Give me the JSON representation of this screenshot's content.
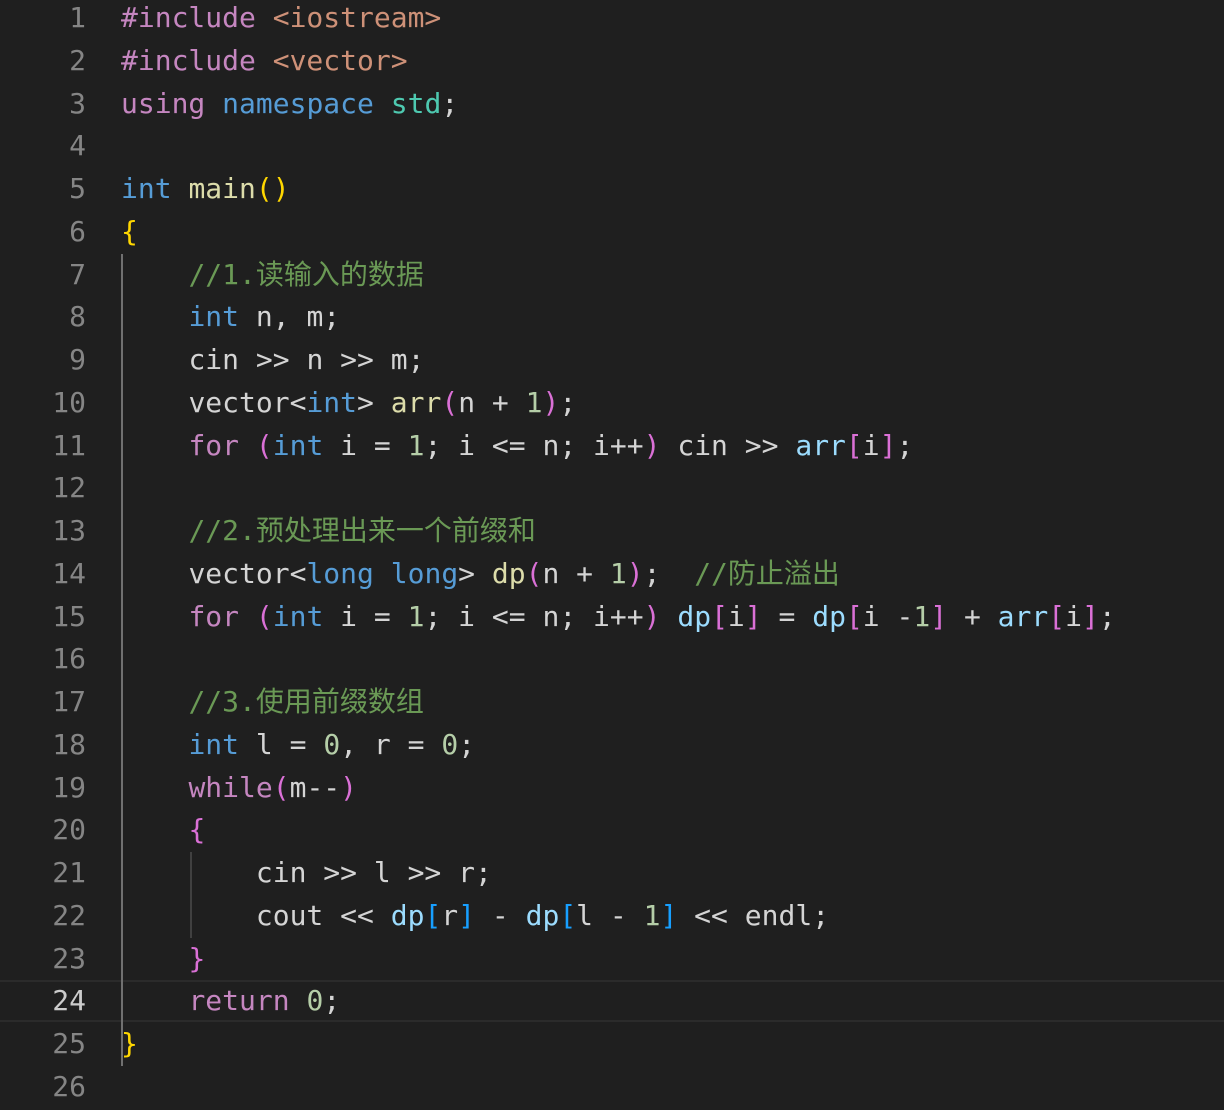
{
  "editor": {
    "language": "cpp",
    "theme": {
      "background": "#1f1f1f",
      "line_number": "#858585",
      "line_number_active": "#cccccc",
      "current_line_border": "#2b2b2b",
      "indent_guide": "#404040",
      "indent_guide_active": "#707070"
    },
    "active_line": 24,
    "lines": [
      {
        "number": "1",
        "tokens": [
          {
            "t": "#include",
            "c": "#c586c0"
          },
          {
            "t": " ",
            "c": "#d4d4d4"
          },
          {
            "t": "<iostream>",
            "c": "#ce9178"
          }
        ]
      },
      {
        "number": "2",
        "tokens": [
          {
            "t": "#include",
            "c": "#c586c0"
          },
          {
            "t": " ",
            "c": "#d4d4d4"
          },
          {
            "t": "<vector>",
            "c": "#ce9178"
          }
        ]
      },
      {
        "number": "3",
        "tokens": [
          {
            "t": "using",
            "c": "#c586c0"
          },
          {
            "t": " ",
            "c": "#d4d4d4"
          },
          {
            "t": "namespace",
            "c": "#569cd6"
          },
          {
            "t": " ",
            "c": "#d4d4d4"
          },
          {
            "t": "std",
            "c": "#4ec9b0"
          },
          {
            "t": ";",
            "c": "#d4d4d4"
          }
        ]
      },
      {
        "number": "4",
        "tokens": []
      },
      {
        "number": "5",
        "tokens": [
          {
            "t": "int",
            "c": "#569cd6"
          },
          {
            "t": " ",
            "c": "#d4d4d4"
          },
          {
            "t": "main",
            "c": "#dcdcaa"
          },
          {
            "t": "()",
            "c": "#ffd700"
          }
        ]
      },
      {
        "number": "6",
        "tokens": [
          {
            "t": "{",
            "c": "#ffd700"
          }
        ]
      },
      {
        "number": "7",
        "tokens": [
          {
            "t": "    ",
            "c": "#d4d4d4"
          },
          {
            "t": "//1.",
            "c": "#6a9955"
          },
          {
            "t": "读输入的数据",
            "c": "#6a9955",
            "cjk": true
          }
        ]
      },
      {
        "number": "8",
        "tokens": [
          {
            "t": "    ",
            "c": "#d4d4d4"
          },
          {
            "t": "int",
            "c": "#569cd6"
          },
          {
            "t": " n, m;",
            "c": "#d4d4d4"
          }
        ]
      },
      {
        "number": "9",
        "tokens": [
          {
            "t": "    ",
            "c": "#d4d4d4"
          },
          {
            "t": "cin >> n >> m;",
            "c": "#d4d4d4"
          }
        ]
      },
      {
        "number": "10",
        "tokens": [
          {
            "t": "    ",
            "c": "#d4d4d4"
          },
          {
            "t": "vector<",
            "c": "#d4d4d4"
          },
          {
            "t": "int",
            "c": "#569cd6"
          },
          {
            "t": "> ",
            "c": "#d4d4d4"
          },
          {
            "t": "arr",
            "c": "#dcdcaa"
          },
          {
            "t": "(",
            "c": "#da70d6"
          },
          {
            "t": "n + ",
            "c": "#d4d4d4"
          },
          {
            "t": "1",
            "c": "#b5cea8"
          },
          {
            "t": ")",
            "c": "#da70d6"
          },
          {
            "t": ";",
            "c": "#d4d4d4"
          }
        ]
      },
      {
        "number": "11",
        "tokens": [
          {
            "t": "    ",
            "c": "#d4d4d4"
          },
          {
            "t": "for",
            "c": "#c586c0"
          },
          {
            "t": " ",
            "c": "#d4d4d4"
          },
          {
            "t": "(",
            "c": "#da70d6"
          },
          {
            "t": "int",
            "c": "#569cd6"
          },
          {
            "t": " i = ",
            "c": "#d4d4d4"
          },
          {
            "t": "1",
            "c": "#b5cea8"
          },
          {
            "t": "; i <= n; i++",
            "c": "#d4d4d4"
          },
          {
            "t": ")",
            "c": "#da70d6"
          },
          {
            "t": " cin >> ",
            "c": "#d4d4d4"
          },
          {
            "t": "arr",
            "c": "#9cdcfe"
          },
          {
            "t": "[",
            "c": "#da70d6"
          },
          {
            "t": "i",
            "c": "#d4d4d4"
          },
          {
            "t": "]",
            "c": "#da70d6"
          },
          {
            "t": ";",
            "c": "#d4d4d4"
          }
        ]
      },
      {
        "number": "12",
        "tokens": []
      },
      {
        "number": "13",
        "tokens": [
          {
            "t": "    ",
            "c": "#d4d4d4"
          },
          {
            "t": "//2.",
            "c": "#6a9955"
          },
          {
            "t": "预处理出来一个前缀和",
            "c": "#6a9955",
            "cjk": true
          }
        ]
      },
      {
        "number": "14",
        "tokens": [
          {
            "t": "    ",
            "c": "#d4d4d4"
          },
          {
            "t": "vector<",
            "c": "#d4d4d4"
          },
          {
            "t": "long long",
            "c": "#569cd6"
          },
          {
            "t": "> ",
            "c": "#d4d4d4"
          },
          {
            "t": "dp",
            "c": "#dcdcaa"
          },
          {
            "t": "(",
            "c": "#da70d6"
          },
          {
            "t": "n + ",
            "c": "#d4d4d4"
          },
          {
            "t": "1",
            "c": "#b5cea8"
          },
          {
            "t": ")",
            "c": "#da70d6"
          },
          {
            "t": ";  ",
            "c": "#d4d4d4"
          },
          {
            "t": "//",
            "c": "#6a9955"
          },
          {
            "t": "防止溢出",
            "c": "#6a9955",
            "cjk": true
          }
        ]
      },
      {
        "number": "15",
        "tokens": [
          {
            "t": "    ",
            "c": "#d4d4d4"
          },
          {
            "t": "for",
            "c": "#c586c0"
          },
          {
            "t": " ",
            "c": "#d4d4d4"
          },
          {
            "t": "(",
            "c": "#da70d6"
          },
          {
            "t": "int",
            "c": "#569cd6"
          },
          {
            "t": " i = ",
            "c": "#d4d4d4"
          },
          {
            "t": "1",
            "c": "#b5cea8"
          },
          {
            "t": "; i <= n; i++",
            "c": "#d4d4d4"
          },
          {
            "t": ")",
            "c": "#da70d6"
          },
          {
            "t": " ",
            "c": "#d4d4d4"
          },
          {
            "t": "dp",
            "c": "#9cdcfe"
          },
          {
            "t": "[",
            "c": "#da70d6"
          },
          {
            "t": "i",
            "c": "#d4d4d4"
          },
          {
            "t": "]",
            "c": "#da70d6"
          },
          {
            "t": " = ",
            "c": "#d4d4d4"
          },
          {
            "t": "dp",
            "c": "#9cdcfe"
          },
          {
            "t": "[",
            "c": "#da70d6"
          },
          {
            "t": "i -",
            "c": "#d4d4d4"
          },
          {
            "t": "1",
            "c": "#b5cea8"
          },
          {
            "t": "]",
            "c": "#da70d6"
          },
          {
            "t": " + ",
            "c": "#d4d4d4"
          },
          {
            "t": "arr",
            "c": "#9cdcfe"
          },
          {
            "t": "[",
            "c": "#da70d6"
          },
          {
            "t": "i",
            "c": "#d4d4d4"
          },
          {
            "t": "]",
            "c": "#da70d6"
          },
          {
            "t": ";",
            "c": "#d4d4d4"
          }
        ]
      },
      {
        "number": "16",
        "tokens": []
      },
      {
        "number": "17",
        "tokens": [
          {
            "t": "    ",
            "c": "#d4d4d4"
          },
          {
            "t": "//3.",
            "c": "#6a9955"
          },
          {
            "t": "使用前缀数组",
            "c": "#6a9955",
            "cjk": true
          }
        ]
      },
      {
        "number": "18",
        "tokens": [
          {
            "t": "    ",
            "c": "#d4d4d4"
          },
          {
            "t": "int",
            "c": "#569cd6"
          },
          {
            "t": " l = ",
            "c": "#d4d4d4"
          },
          {
            "t": "0",
            "c": "#b5cea8"
          },
          {
            "t": ", r = ",
            "c": "#d4d4d4"
          },
          {
            "t": "0",
            "c": "#b5cea8"
          },
          {
            "t": ";",
            "c": "#d4d4d4"
          }
        ]
      },
      {
        "number": "19",
        "tokens": [
          {
            "t": "    ",
            "c": "#d4d4d4"
          },
          {
            "t": "while",
            "c": "#c586c0"
          },
          {
            "t": "(",
            "c": "#da70d6"
          },
          {
            "t": "m--",
            "c": "#d4d4d4"
          },
          {
            "t": ")",
            "c": "#da70d6"
          }
        ]
      },
      {
        "number": "20",
        "tokens": [
          {
            "t": "    ",
            "c": "#d4d4d4"
          },
          {
            "t": "{",
            "c": "#da70d6"
          }
        ]
      },
      {
        "number": "21",
        "tokens": [
          {
            "t": "        ",
            "c": "#d4d4d4"
          },
          {
            "t": "cin >> l >> r;",
            "c": "#d4d4d4"
          }
        ]
      },
      {
        "number": "22",
        "tokens": [
          {
            "t": "        ",
            "c": "#d4d4d4"
          },
          {
            "t": "cout << ",
            "c": "#d4d4d4"
          },
          {
            "t": "dp",
            "c": "#9cdcfe"
          },
          {
            "t": "[",
            "c": "#179fff"
          },
          {
            "t": "r",
            "c": "#d4d4d4"
          },
          {
            "t": "]",
            "c": "#179fff"
          },
          {
            "t": " - ",
            "c": "#d4d4d4"
          },
          {
            "t": "dp",
            "c": "#9cdcfe"
          },
          {
            "t": "[",
            "c": "#179fff"
          },
          {
            "t": "l - ",
            "c": "#d4d4d4"
          },
          {
            "t": "1",
            "c": "#b5cea8"
          },
          {
            "t": "]",
            "c": "#179fff"
          },
          {
            "t": " << endl;",
            "c": "#d4d4d4"
          }
        ]
      },
      {
        "number": "23",
        "tokens": [
          {
            "t": "    ",
            "c": "#d4d4d4"
          },
          {
            "t": "}",
            "c": "#da70d6"
          }
        ]
      },
      {
        "number": "24",
        "tokens": [
          {
            "t": "    ",
            "c": "#d4d4d4"
          },
          {
            "t": "return",
            "c": "#c586c0"
          },
          {
            "t": " ",
            "c": "#d4d4d4"
          },
          {
            "t": "0",
            "c": "#b5cea8"
          },
          {
            "t": ";",
            "c": "#d4d4d4"
          }
        ]
      },
      {
        "number": "25",
        "tokens": [
          {
            "t": "}",
            "c": "#ffd700"
          }
        ]
      },
      {
        "number": "26",
        "tokens": []
      }
    ]
  }
}
